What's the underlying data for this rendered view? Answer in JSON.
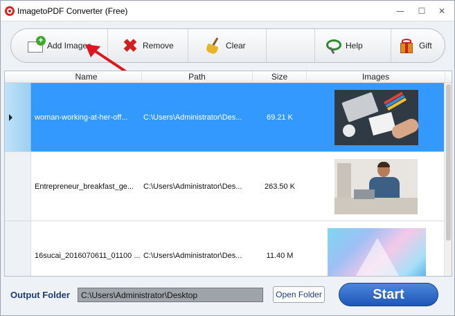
{
  "window": {
    "title": "ImagetoPDF Converter (Free)",
    "controls": {
      "minimize": "—",
      "maximize": "☐",
      "close": "✕"
    }
  },
  "toolbar": {
    "add_label": "Add Images",
    "remove_label": "Remove",
    "clear_label": "Clear",
    "help_label": "Help",
    "gift_label": "Gift"
  },
  "grid": {
    "columns": [
      "Name",
      "Path",
      "Size",
      "Images"
    ],
    "rows": [
      {
        "name": "woman-working-at-her-off...",
        "path": "C:\\Users\\Administrator\\Des...",
        "size": "69.21 K",
        "selected": true
      },
      {
        "name": "Entrepreneur_breakfast_ge...",
        "path": "C:\\Users\\Administrator\\Des...",
        "size": "263.50 K",
        "selected": false
      },
      {
        "name": "16sucai_2016070611_01100 ...",
        "path": "C:\\Users\\Administrator\\Des...",
        "size": "11.40 M",
        "selected": false
      }
    ]
  },
  "output": {
    "label": "Output Folder",
    "path": "C:\\Users\\Administrator\\Desktop",
    "open_folder_label": "Open Folder",
    "start_label": "Start"
  },
  "colors": {
    "selection": "#3399ff",
    "start_button": "#2a62c4",
    "output_label": "#1f3c6e",
    "annotation_arrow": "#e0141e"
  },
  "icons": [
    "app-logo-icon",
    "add-images-icon",
    "remove-x-icon",
    "broom-icon",
    "help-icon",
    "gift-icon"
  ]
}
